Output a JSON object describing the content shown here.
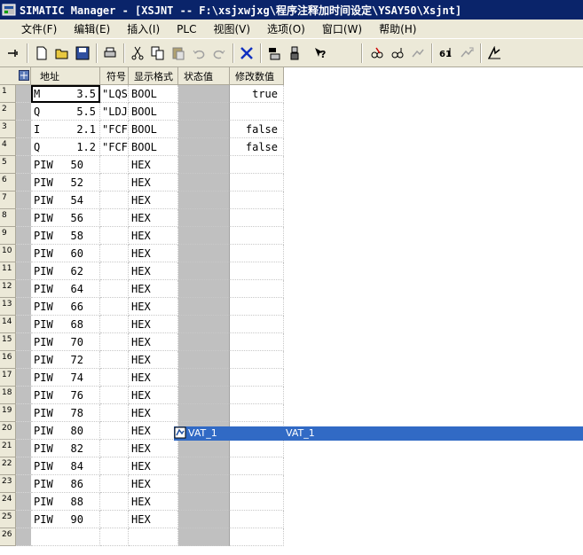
{
  "window": {
    "title": "SIMATIC Manager - [XSJNT -- F:\\xsjxwjxg\\程序注释加时间设定\\YSAY50\\Xsjnt]"
  },
  "menu": [
    "文件(F)",
    "编辑(E)",
    "插入(I)",
    "PLC",
    "视图(V)",
    "选项(O)",
    "窗口(W)",
    "帮助(H)"
  ],
  "toolbar": {
    "icons": [
      "pin-icon",
      "new-icon",
      "open-icon",
      "save-icon",
      "print-icon",
      "cut-icon",
      "copy-icon",
      "paste-icon",
      "undo-icon",
      "redo-icon",
      "delete-icon",
      "download-icon",
      "monitor-icon",
      "help-icon",
      "glasses-icon",
      "glasses-variable-icon",
      "trigger-icon",
      "modify-icon",
      "force-icon",
      "modify-now-icon"
    ]
  },
  "table": {
    "headers": {
      "address": "地址",
      "symbol": "符号",
      "format": "显示格式",
      "status": "状态值",
      "modify": "修改数值"
    },
    "rows": [
      {
        "n": "1",
        "op": "M",
        "num": "3.5",
        "sym": "\"LQS",
        "fmt": "BOOL",
        "mod": "true"
      },
      {
        "n": "2",
        "op": "Q",
        "num": "5.5",
        "sym": "\"LDJ",
        "fmt": "BOOL",
        "mod": ""
      },
      {
        "n": "3",
        "op": "I",
        "num": "2.1",
        "sym": "\"FCF",
        "fmt": "BOOL",
        "mod": "false"
      },
      {
        "n": "4",
        "op": "Q",
        "num": "1.2",
        "sym": "\"FCF",
        "fmt": "BOOL",
        "mod": "false"
      },
      {
        "n": "5",
        "op": "PIW",
        "num": "50",
        "sym": "",
        "fmt": "HEX",
        "mod": ""
      },
      {
        "n": "6",
        "op": "PIW",
        "num": "52",
        "sym": "",
        "fmt": "HEX",
        "mod": ""
      },
      {
        "n": "7",
        "op": "PIW",
        "num": "54",
        "sym": "",
        "fmt": "HEX",
        "mod": ""
      },
      {
        "n": "8",
        "op": "PIW",
        "num": "56",
        "sym": "",
        "fmt": "HEX",
        "mod": ""
      },
      {
        "n": "9",
        "op": "PIW",
        "num": "58",
        "sym": "",
        "fmt": "HEX",
        "mod": ""
      },
      {
        "n": "10",
        "op": "PIW",
        "num": "60",
        "sym": "",
        "fmt": "HEX",
        "mod": ""
      },
      {
        "n": "11",
        "op": "PIW",
        "num": "62",
        "sym": "",
        "fmt": "HEX",
        "mod": ""
      },
      {
        "n": "12",
        "op": "PIW",
        "num": "64",
        "sym": "",
        "fmt": "HEX",
        "mod": ""
      },
      {
        "n": "13",
        "op": "PIW",
        "num": "66",
        "sym": "",
        "fmt": "HEX",
        "mod": ""
      },
      {
        "n": "14",
        "op": "PIW",
        "num": "68",
        "sym": "",
        "fmt": "HEX",
        "mod": ""
      },
      {
        "n": "15",
        "op": "PIW",
        "num": "70",
        "sym": "",
        "fmt": "HEX",
        "mod": ""
      },
      {
        "n": "16",
        "op": "PIW",
        "num": "72",
        "sym": "",
        "fmt": "HEX",
        "mod": ""
      },
      {
        "n": "17",
        "op": "PIW",
        "num": "74",
        "sym": "",
        "fmt": "HEX",
        "mod": ""
      },
      {
        "n": "18",
        "op": "PIW",
        "num": "76",
        "sym": "",
        "fmt": "HEX",
        "mod": ""
      },
      {
        "n": "19",
        "op": "PIW",
        "num": "78",
        "sym": "",
        "fmt": "HEX",
        "mod": ""
      },
      {
        "n": "20",
        "op": "PIW",
        "num": "80",
        "sym": "",
        "fmt": "HEX",
        "mod": ""
      },
      {
        "n": "21",
        "op": "PIW",
        "num": "82",
        "sym": "",
        "fmt": "HEX",
        "mod": ""
      },
      {
        "n": "22",
        "op": "PIW",
        "num": "84",
        "sym": "",
        "fmt": "HEX",
        "mod": ""
      },
      {
        "n": "23",
        "op": "PIW",
        "num": "86",
        "sym": "",
        "fmt": "HEX",
        "mod": ""
      },
      {
        "n": "24",
        "op": "PIW",
        "num": "88",
        "sym": "",
        "fmt": "HEX",
        "mod": ""
      },
      {
        "n": "25",
        "op": "PIW",
        "num": "90",
        "sym": "",
        "fmt": "HEX",
        "mod": ""
      },
      {
        "n": "26",
        "op": "",
        "num": "",
        "sym": "",
        "fmt": "",
        "mod": ""
      }
    ]
  },
  "taskbar_strip": {
    "label1": "VAT_1",
    "label2": "VAT_1"
  },
  "colors": {
    "title_bg": "#0a246a",
    "chrome": "#ece9d8",
    "status_col": "#c0c0c0",
    "highlight": "#316ac5"
  }
}
